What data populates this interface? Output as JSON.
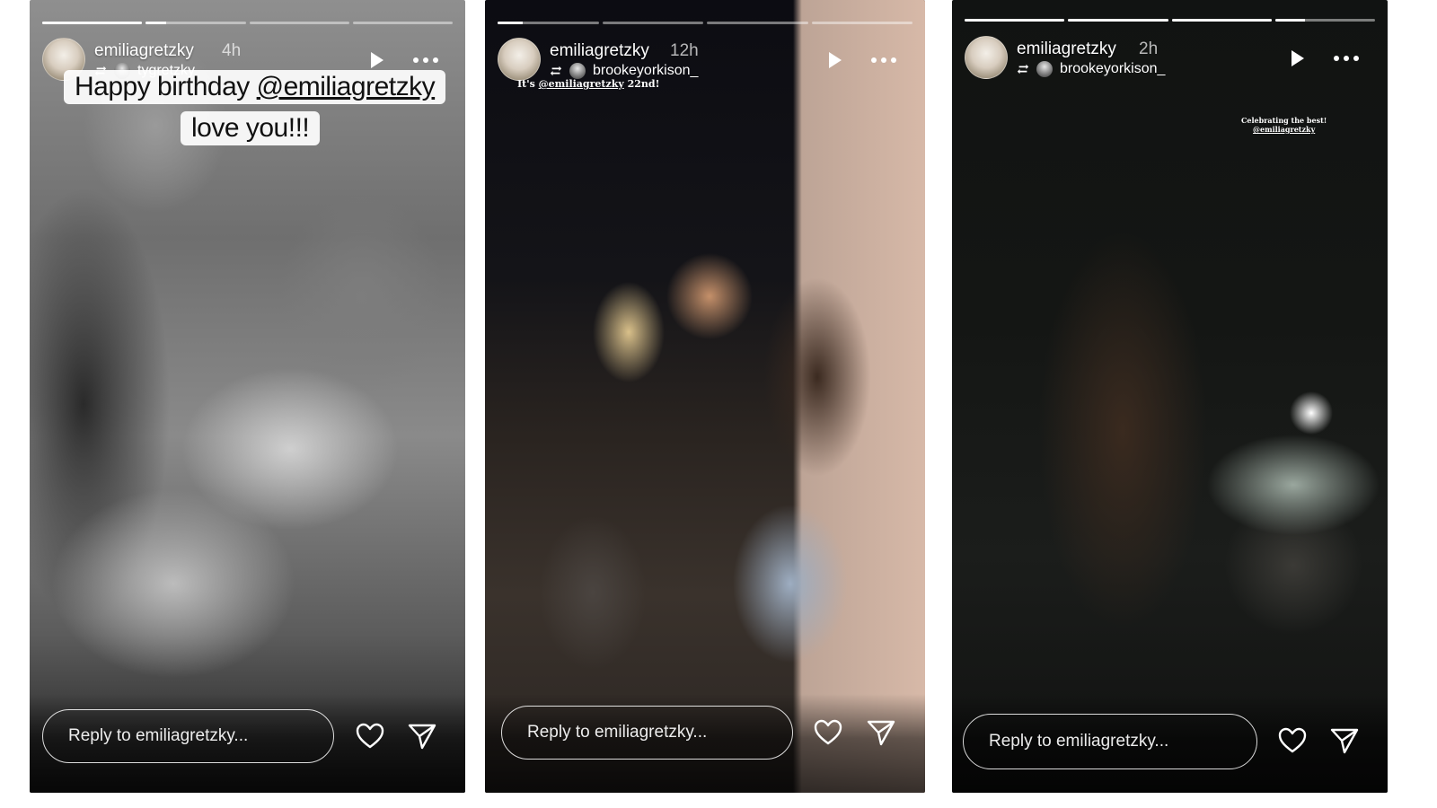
{
  "stories": [
    {
      "username": "emiliagretzky",
      "time": "4h",
      "reposted_from": "tygretzky",
      "progress": {
        "segments": 4,
        "active_index": 1,
        "active_fill": 0.2
      },
      "caption_lines": [
        {
          "text": "Happy birthday ",
          "mention": "@emiliagretzky"
        },
        {
          "text": "love you!!!",
          "mention": ""
        }
      ],
      "reply_placeholder": "Reply to emiliagretzky..."
    },
    {
      "username": "emiliagretzky",
      "time": "12h",
      "reposted_from": "brookeyorkison_",
      "progress": {
        "segments": 4,
        "active_index": 0,
        "active_fill": 0.25
      },
      "small_text": {
        "text": "It's ",
        "mention": "@emiliagretzky",
        "suffix": " 22nd!"
      },
      "reply_placeholder": "Reply to emiliagretzky..."
    },
    {
      "username": "emiliagretzky",
      "time": "2h",
      "reposted_from": "brookeyorkison_",
      "progress": {
        "segments": 4,
        "active_index": 3,
        "active_fill": 0.3
      },
      "small_text": {
        "line1": "Celebrating the best!",
        "mention": "@emiliagretzky"
      },
      "reply_placeholder": "Reply to emiliagretzky..."
    }
  ],
  "colors": {
    "text": "#ffffff",
    "caption_bg": "#ffffff"
  }
}
